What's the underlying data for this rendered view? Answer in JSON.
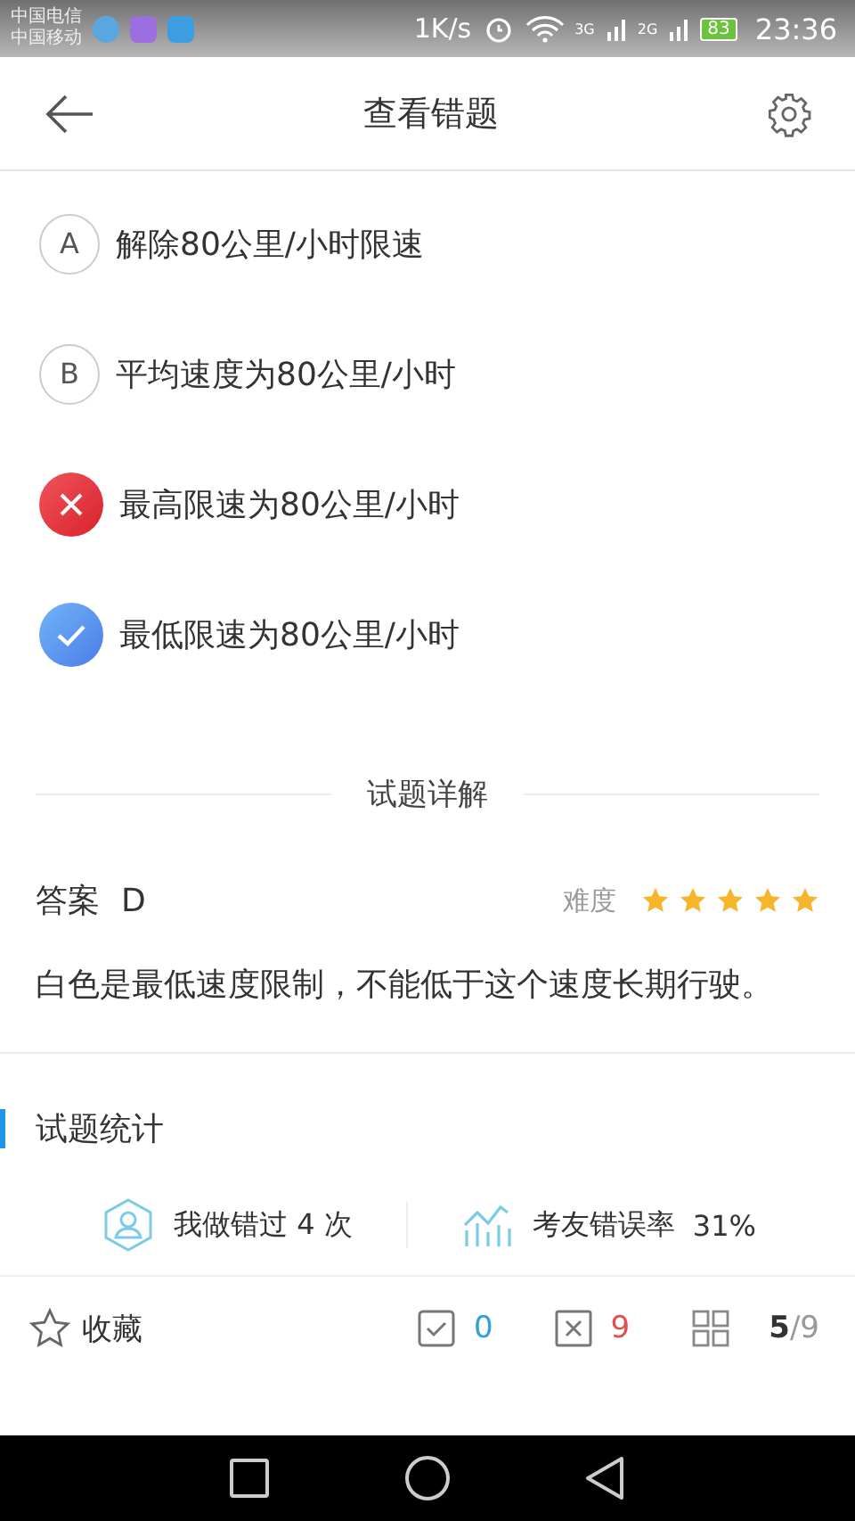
{
  "status_bar": {
    "carriers": [
      "中国电信",
      "中国移动"
    ],
    "speed": "1K/s",
    "network_1": "3G",
    "network_2": "2G",
    "battery": "83",
    "time": "23:36"
  },
  "header": {
    "title": "查看错题"
  },
  "options": [
    {
      "letter": "A",
      "text": "解除80公里/小时限速",
      "kind": "plain"
    },
    {
      "letter": "B",
      "text": "平均速度为80公里/小时",
      "kind": "plain"
    },
    {
      "text": "最高限速为80公里/小时",
      "kind": "wrong"
    },
    {
      "text": "最低限速为80公里/小时",
      "kind": "correct"
    }
  ],
  "detail": {
    "heading": "试题详解",
    "answer_label": "答案",
    "answer": "D",
    "difficulty_label": "难度",
    "stars": 5,
    "explanation": "白色是最低速度限制，不能低于这个速度长期行驶。"
  },
  "stats": {
    "heading": "试题统计",
    "my_errors": "我做错过 4 次",
    "error_rate_label": "考友错误率",
    "error_rate": "31%"
  },
  "bottom_bar": {
    "favorite": "收藏",
    "correct_count": "0",
    "wrong_count": "9",
    "progress": "**5**/9"
  }
}
